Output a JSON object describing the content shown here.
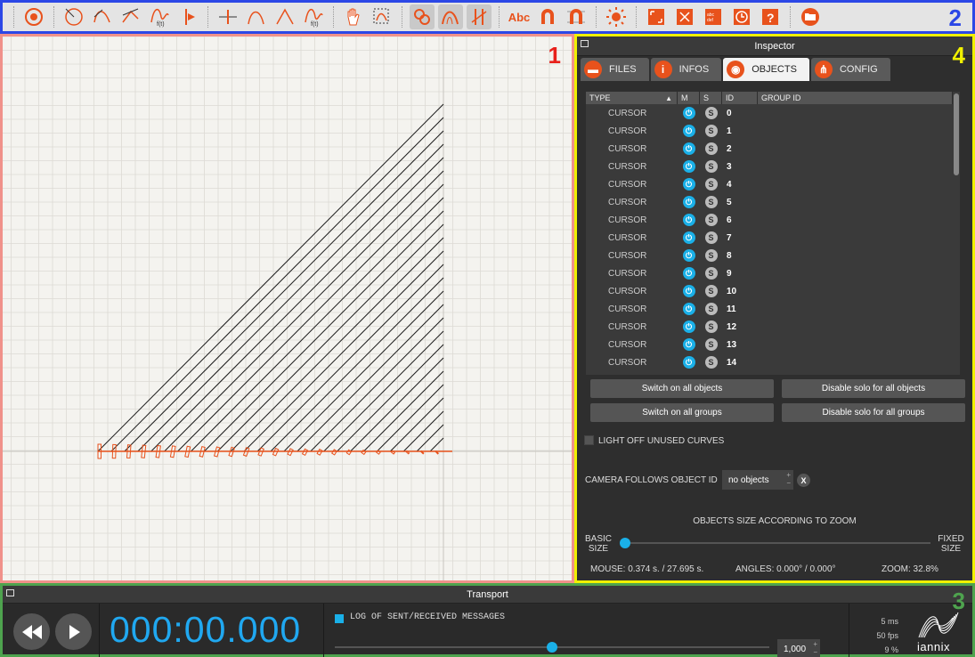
{
  "colors": {
    "accent": "#e8521c",
    "blue": "#1ab0e8",
    "toolbar_border": "#2b47e6",
    "canvas_border": "#f0918a",
    "inspector_border": "#f0f000",
    "transport_border": "#4ea34e",
    "region1": "#e8211b",
    "region2": "#2b47e6",
    "region3": "#4ea34e",
    "region4": "#f0f000"
  },
  "region_numbers": {
    "canvas": "1",
    "toolbar": "2",
    "transport": "3",
    "inspector": "4"
  },
  "toolbar": {
    "icons": [
      "add-cursor-icon",
      "add-circle-curve-icon",
      "add-bezier-curve-icon",
      "add-line-curve-icon",
      "add-function-curve-icon",
      "add-trigger-icon",
      "add-point-icon",
      "add-smooth-curve-icon",
      "add-angle-curve-icon",
      "add-equation-curve-icon",
      "hand-icon",
      "select-icon",
      "snap-points-icon",
      "snap-curves-icon",
      "snap-triggers-icon",
      "abc-label-icon",
      "magnet-icon",
      "magnet-grid-icon",
      "sun-icon",
      "fullscreen-icon",
      "fit-view-icon",
      "score-icon",
      "clock-icon",
      "help-icon",
      "folder-icon"
    ],
    "abc": "Abc"
  },
  "inspector": {
    "title": "Inspector",
    "tabs": [
      {
        "label": "FILES",
        "icon": "folder-icon"
      },
      {
        "label": "INFOS",
        "icon": "info-icon"
      },
      {
        "label": "OBJECTS",
        "icon": "eye-icon"
      },
      {
        "label": "CONFIG",
        "icon": "network-icon"
      }
    ],
    "columns": [
      "TYPE",
      "M",
      "S",
      "ID",
      "GROUP ID"
    ],
    "rows": [
      {
        "type": "CURSOR",
        "id": "0"
      },
      {
        "type": "CURSOR",
        "id": "1"
      },
      {
        "type": "CURSOR",
        "id": "2"
      },
      {
        "type": "CURSOR",
        "id": "3"
      },
      {
        "type": "CURSOR",
        "id": "4"
      },
      {
        "type": "CURSOR",
        "id": "5"
      },
      {
        "type": "CURSOR",
        "id": "6"
      },
      {
        "type": "CURSOR",
        "id": "7"
      },
      {
        "type": "CURSOR",
        "id": "8"
      },
      {
        "type": "CURSOR",
        "id": "9"
      },
      {
        "type": "CURSOR",
        "id": "10"
      },
      {
        "type": "CURSOR",
        "id": "11"
      },
      {
        "type": "CURSOR",
        "id": "12"
      },
      {
        "type": "CURSOR",
        "id": "13"
      },
      {
        "type": "CURSOR",
        "id": "14"
      }
    ],
    "switch_on_objects": "Switch on all objects",
    "disable_solo_objects": "Disable solo for all objects",
    "switch_on_groups": "Switch on all groups",
    "disable_solo_groups": "Disable solo for all groups",
    "light_off": "LIGHT OFF UNUSED CURVES",
    "camera_follows": "CAMERA FOLLOWS OBJECT ID",
    "camera_value": "no objects",
    "clear": "X",
    "objects_size": "OBJECTS SIZE ACCORDING TO ZOOM",
    "basic_size": "BASIC",
    "basic_size2": "SIZE",
    "fixed_size": "FIXED",
    "fixed_size2": "SIZE",
    "size_level": 0,
    "mouse": "MOUSE: 0.374 s. / 27.695 s.",
    "angles": "ANGLES: 0.000° / 0.000°",
    "zoom": "ZOOM: 32.8%"
  },
  "transport": {
    "title": "Transport",
    "time": "000:00.000",
    "log_label": "LOG OF SENT/RECEIVED MESSAGES",
    "speed": "1,000",
    "speed_level": 0.5,
    "ms": "5  ms",
    "fps": "50  fps",
    "pct": "9   %",
    "logo": "iannix"
  }
}
